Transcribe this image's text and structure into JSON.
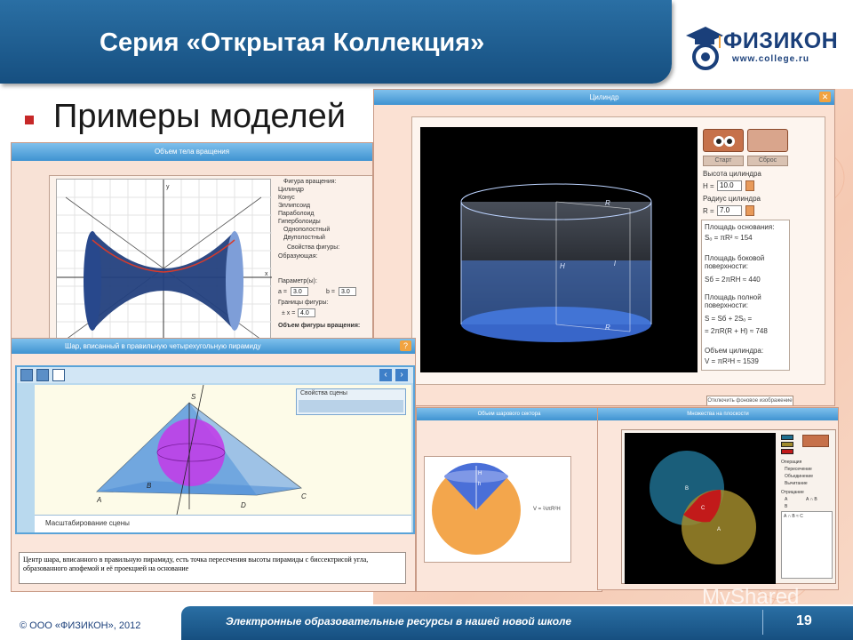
{
  "header": {
    "title": "Серия «Открытая Коллекция»",
    "logo_name": "ФИЗИКОН",
    "logo_url": "www.college.ru"
  },
  "section": {
    "heading": "Примеры моделей"
  },
  "windows": {
    "cylinder": {
      "title": "Цилиндр",
      "start": "Старт",
      "reset": "Сброс",
      "height_label": "Высота цилиндра",
      "H_label": "H =",
      "H_value": "10.0",
      "radius_label": "Радиус цилиндра",
      "R_label": "R =",
      "R_value": "7.0",
      "base_area_label": "Площадь основания:",
      "base_area_formula": "Sₒ = πR² ≈ 154",
      "side_area_label": "Площадь боковой поверхности:",
      "side_area_formula": "Sб = 2πRH ≈ 440",
      "total_area_label": "Площадь полной поверхности:",
      "total_area_formula1": "S = Sб + 2Sₒ =",
      "total_area_formula2": "= 2πR(R + H) ≈ 748",
      "volume_label": "Объем цилиндра:",
      "volume_formula": "V = πR²H ≈ 1539",
      "bg_button": "Отключить фоновое изображение",
      "label_R": "R",
      "label_H": "H",
      "label_l": "l"
    },
    "rotation": {
      "title": "Объем тела вращения",
      "figure_label": "Фигура вращения:",
      "options": [
        "Цилиндр",
        "Конус",
        "Эллипсоид",
        "Параболоид",
        "Гиперболоиды",
        "Однополостный",
        "Двуполостный"
      ],
      "props_label": "Свойства фигуры:",
      "generator_label": "Образующая:",
      "params_label": "Параметр(ы):",
      "a_label": "a =",
      "a_value": "3.0",
      "b_label": "b =",
      "b_value": "3.0",
      "bounds_label": "Границы фигуры:",
      "x_label": "± x =",
      "x_value": "4.0",
      "volume_label": "Объем фигуры вращения:",
      "axis_x": "x",
      "axis_y": "y"
    },
    "pyramid": {
      "title": "Шар, вписанный в правильную четырехугольную пирамиду",
      "scene_props": "Свойства сцены",
      "scaling": "Масштабирование сцены",
      "vertex_labels": [
        "S",
        "B",
        "A",
        "D",
        "C"
      ],
      "caption": "Центр шара, вписанного в правильную пирамиду, есть точка пересечения высоты пирамиды с биссектрисой угла, образованного апофемой и её проекцией на основание"
    },
    "sector": {
      "title": "Объем шарового сектора",
      "formula": "V = ⅔πR²H",
      "label_H": "H",
      "label_h": "h"
    },
    "sets": {
      "title": "Множества на плоскости",
      "operation_label": "Операция",
      "ops": [
        "Пересечение",
        "Объединение",
        "Вычитание"
      ],
      "reflect_label": "Отрицание",
      "refl_ops": [
        "A",
        "B",
        "A ∩ B"
      ],
      "result": "A ∩ B ≈ C",
      "label_A": "A",
      "label_B": "B",
      "label_C": "C"
    }
  },
  "footer": {
    "copyright": "© ООО «ФИЗИКОН», 2012",
    "title": "Электронные образовательные ресурсы в нашей новой школе",
    "page": "19",
    "watermark": "MyShared"
  }
}
